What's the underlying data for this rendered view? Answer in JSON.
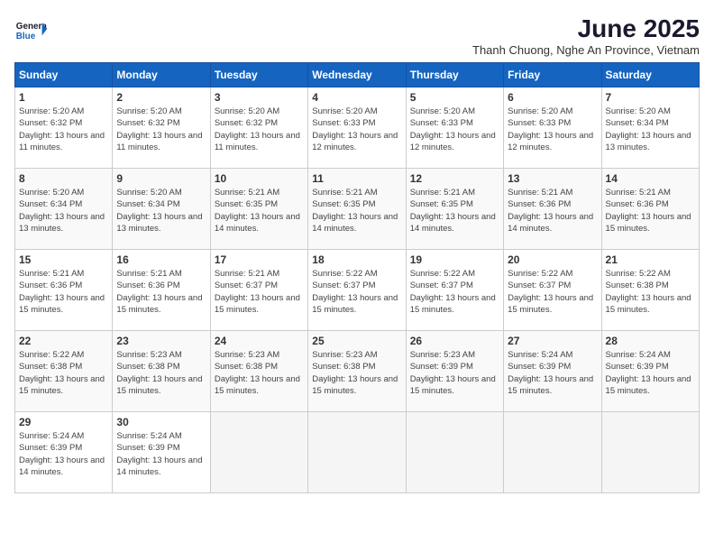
{
  "logo": {
    "line1": "General",
    "line2": "Blue"
  },
  "title": "June 2025",
  "subtitle": "Thanh Chuong, Nghe An Province, Vietnam",
  "weekdays": [
    "Sunday",
    "Monday",
    "Tuesday",
    "Wednesday",
    "Thursday",
    "Friday",
    "Saturday"
  ],
  "weeks": [
    [
      {
        "day": "1",
        "sunrise": "5:20 AM",
        "sunset": "6:32 PM",
        "daylight": "13 hours and 11 minutes."
      },
      {
        "day": "2",
        "sunrise": "5:20 AM",
        "sunset": "6:32 PM",
        "daylight": "13 hours and 11 minutes."
      },
      {
        "day": "3",
        "sunrise": "5:20 AM",
        "sunset": "6:32 PM",
        "daylight": "13 hours and 11 minutes."
      },
      {
        "day": "4",
        "sunrise": "5:20 AM",
        "sunset": "6:33 PM",
        "daylight": "13 hours and 12 minutes."
      },
      {
        "day": "5",
        "sunrise": "5:20 AM",
        "sunset": "6:33 PM",
        "daylight": "13 hours and 12 minutes."
      },
      {
        "day": "6",
        "sunrise": "5:20 AM",
        "sunset": "6:33 PM",
        "daylight": "13 hours and 12 minutes."
      },
      {
        "day": "7",
        "sunrise": "5:20 AM",
        "sunset": "6:34 PM",
        "daylight": "13 hours and 13 minutes."
      }
    ],
    [
      {
        "day": "8",
        "sunrise": "5:20 AM",
        "sunset": "6:34 PM",
        "daylight": "13 hours and 13 minutes."
      },
      {
        "day": "9",
        "sunrise": "5:20 AM",
        "sunset": "6:34 PM",
        "daylight": "13 hours and 13 minutes."
      },
      {
        "day": "10",
        "sunrise": "5:21 AM",
        "sunset": "6:35 PM",
        "daylight": "13 hours and 14 minutes."
      },
      {
        "day": "11",
        "sunrise": "5:21 AM",
        "sunset": "6:35 PM",
        "daylight": "13 hours and 14 minutes."
      },
      {
        "day": "12",
        "sunrise": "5:21 AM",
        "sunset": "6:35 PM",
        "daylight": "13 hours and 14 minutes."
      },
      {
        "day": "13",
        "sunrise": "5:21 AM",
        "sunset": "6:36 PM",
        "daylight": "13 hours and 14 minutes."
      },
      {
        "day": "14",
        "sunrise": "5:21 AM",
        "sunset": "6:36 PM",
        "daylight": "13 hours and 15 minutes."
      }
    ],
    [
      {
        "day": "15",
        "sunrise": "5:21 AM",
        "sunset": "6:36 PM",
        "daylight": "13 hours and 15 minutes."
      },
      {
        "day": "16",
        "sunrise": "5:21 AM",
        "sunset": "6:36 PM",
        "daylight": "13 hours and 15 minutes."
      },
      {
        "day": "17",
        "sunrise": "5:21 AM",
        "sunset": "6:37 PM",
        "daylight": "13 hours and 15 minutes."
      },
      {
        "day": "18",
        "sunrise": "5:22 AM",
        "sunset": "6:37 PM",
        "daylight": "13 hours and 15 minutes."
      },
      {
        "day": "19",
        "sunrise": "5:22 AM",
        "sunset": "6:37 PM",
        "daylight": "13 hours and 15 minutes."
      },
      {
        "day": "20",
        "sunrise": "5:22 AM",
        "sunset": "6:37 PM",
        "daylight": "13 hours and 15 minutes."
      },
      {
        "day": "21",
        "sunrise": "5:22 AM",
        "sunset": "6:38 PM",
        "daylight": "13 hours and 15 minutes."
      }
    ],
    [
      {
        "day": "22",
        "sunrise": "5:22 AM",
        "sunset": "6:38 PM",
        "daylight": "13 hours and 15 minutes."
      },
      {
        "day": "23",
        "sunrise": "5:23 AM",
        "sunset": "6:38 PM",
        "daylight": "13 hours and 15 minutes."
      },
      {
        "day": "24",
        "sunrise": "5:23 AM",
        "sunset": "6:38 PM",
        "daylight": "13 hours and 15 minutes."
      },
      {
        "day": "25",
        "sunrise": "5:23 AM",
        "sunset": "6:38 PM",
        "daylight": "13 hours and 15 minutes."
      },
      {
        "day": "26",
        "sunrise": "5:23 AM",
        "sunset": "6:39 PM",
        "daylight": "13 hours and 15 minutes."
      },
      {
        "day": "27",
        "sunrise": "5:24 AM",
        "sunset": "6:39 PM",
        "daylight": "13 hours and 15 minutes."
      },
      {
        "day": "28",
        "sunrise": "5:24 AM",
        "sunset": "6:39 PM",
        "daylight": "13 hours and 15 minutes."
      }
    ],
    [
      {
        "day": "29",
        "sunrise": "5:24 AM",
        "sunset": "6:39 PM",
        "daylight": "13 hours and 14 minutes."
      },
      {
        "day": "30",
        "sunrise": "5:24 AM",
        "sunset": "6:39 PM",
        "daylight": "13 hours and 14 minutes."
      },
      null,
      null,
      null,
      null,
      null
    ]
  ]
}
